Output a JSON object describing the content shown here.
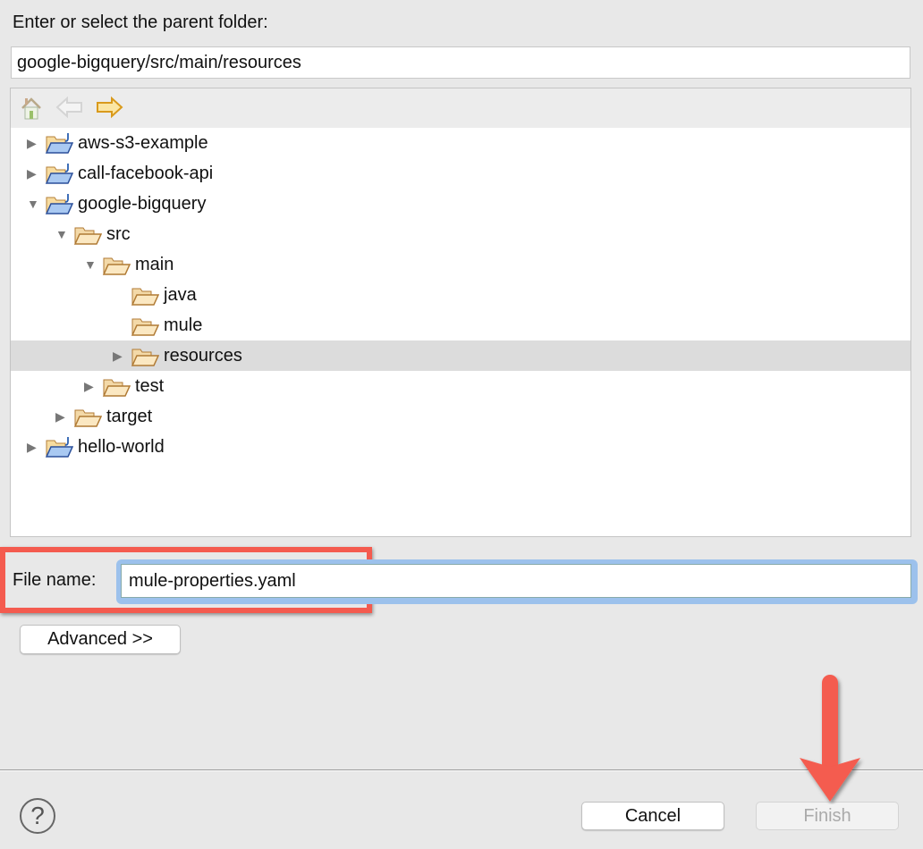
{
  "prompt": "Enter or select the parent folder:",
  "folder_path": "google-bigquery/src/main/resources",
  "toolbar": {
    "icons": [
      "home-icon",
      "back-icon",
      "forward-icon"
    ]
  },
  "tree": [
    {
      "label": "aws-s3-example",
      "level": 0,
      "toggle": "collapsed",
      "type": "project"
    },
    {
      "label": "call-facebook-api",
      "level": 0,
      "toggle": "collapsed",
      "type": "project"
    },
    {
      "label": "google-bigquery",
      "level": 0,
      "toggle": "expanded",
      "type": "project"
    },
    {
      "label": "src",
      "level": 1,
      "toggle": "expanded",
      "type": "folder"
    },
    {
      "label": "main",
      "level": 2,
      "toggle": "expanded",
      "type": "folder"
    },
    {
      "label": "java",
      "level": 3,
      "toggle": "none",
      "type": "folder"
    },
    {
      "label": "mule",
      "level": 3,
      "toggle": "none",
      "type": "folder"
    },
    {
      "label": "resources",
      "level": 3,
      "toggle": "collapsed",
      "type": "folder",
      "selected": true
    },
    {
      "label": "test",
      "level": 2,
      "toggle": "collapsed",
      "type": "folder"
    },
    {
      "label": "target",
      "level": 1,
      "toggle": "collapsed",
      "type": "folder"
    },
    {
      "label": "hello-world",
      "level": 0,
      "toggle": "collapsed",
      "type": "project"
    }
  ],
  "file_name_label": "File name:",
  "file_name_value": "mule-properties.yaml",
  "advanced_label": "Advanced >>",
  "help_label": "?",
  "cancel_label": "Cancel",
  "finish_label": "Finish",
  "colors": {
    "annotation": "#f45b4f",
    "focus": "#9cc1ec",
    "selection": "#dcdcdc"
  }
}
